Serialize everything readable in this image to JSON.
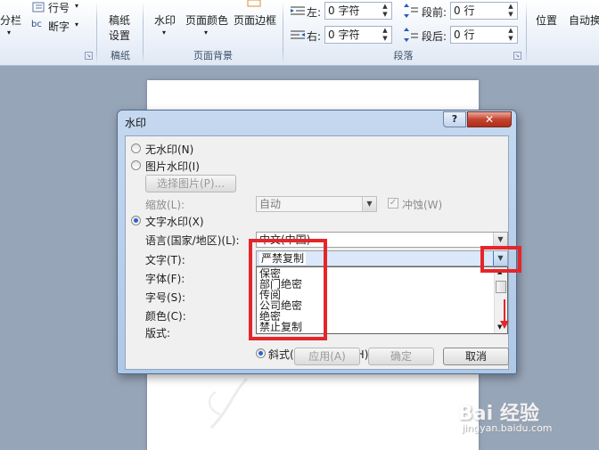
{
  "ribbon": {
    "columns_label": "分栏",
    "line_numbers_label": "行号",
    "hyphenation_label": "断字",
    "manuscript_label_1": "稿纸",
    "manuscript_label_2": "设置",
    "manuscript_group": "稿纸",
    "watermark_label": "水印",
    "page_color_label": "页面颜色",
    "page_border_label": "页面边框",
    "page_background_group": "页面背景",
    "indent_left_label": "左:",
    "indent_left_value": "0 字符",
    "indent_right_label": "右:",
    "indent_right_value": "0 字符",
    "spacing_before_label": "段前:",
    "spacing_before_value": "0 行",
    "spacing_after_label": "段后:",
    "spacing_after_value": "0 行",
    "paragraph_group": "段落",
    "position_label": "位置",
    "autowrap_label": "自动换"
  },
  "dialog": {
    "title": "水印",
    "help": "?",
    "close": "✕",
    "no_watermark": "无水印(N)",
    "picture_watermark": "图片水印(I)",
    "select_picture": "选择图片(P)...",
    "scale_label": "缩放(L):",
    "scale_value": "自动",
    "washout_label": "冲蚀(W)",
    "text_watermark": "文字水印(X)",
    "language_label": "语言(国家/地区)(L):",
    "language_value": "中文(中国)",
    "text_label": "文字(T):",
    "text_value": "严禁复制",
    "font_label": "字体(F):",
    "size_label": "字号(S):",
    "color_label": "颜色(C):",
    "layout_label": "版式:",
    "diagonal_label": "斜式(D)",
    "horizontal_label": "水平(H)",
    "text_options": [
      "保密",
      "部门绝密",
      "传阅",
      "公司绝密",
      "绝密",
      "禁止复制"
    ],
    "apply": "应用(A)",
    "ok": "确定",
    "cancel": "取消"
  },
  "watermark": {
    "logo": "Bai 经验",
    "url": "jingyan.baidu.com"
  }
}
